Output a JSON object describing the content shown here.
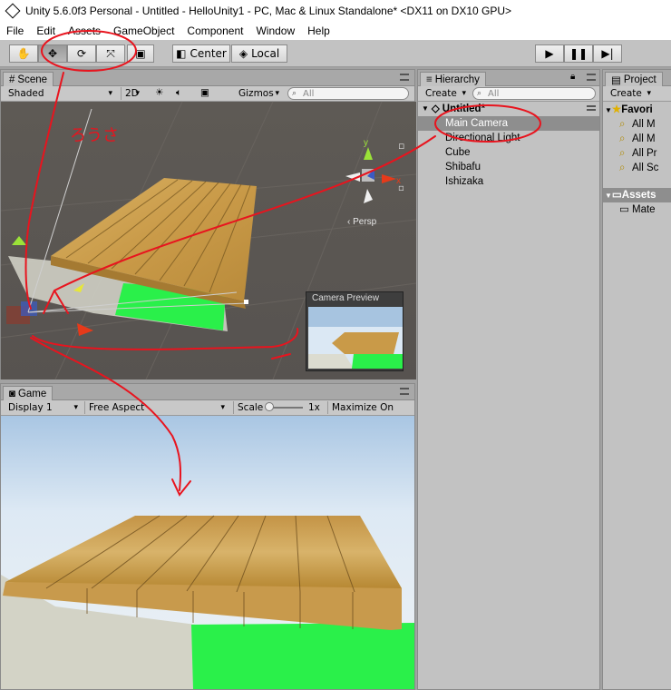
{
  "window": {
    "title": "Unity 5.6.0f3 Personal - Untitled - HelloUnity1 - PC, Mac & Linux Standalone* <DX11 on DX10 GPU>"
  },
  "menu": [
    "File",
    "Edit",
    "Assets",
    "GameObject",
    "Component",
    "Window",
    "Help"
  ],
  "toolbar": {
    "tools": [
      "hand-icon",
      "move-icon",
      "rotate-icon",
      "scale-icon",
      "rect-icon"
    ],
    "pivot": "Center",
    "space": "Local"
  },
  "scene": {
    "tab": "Scene",
    "shading": "Shaded",
    "mode2d": "2D",
    "gizmos": "Gizmos",
    "search_placeholder": "All",
    "persp": "Persp",
    "camera_preview": "Camera Preview",
    "handwritten": "ろうさ"
  },
  "game": {
    "tab": "Game",
    "display": "Display 1",
    "aspect": "Free Aspect",
    "scale_label": "Scale",
    "scale_value": "1x",
    "maximize": "Maximize On Play"
  },
  "hierarchy": {
    "tab": "Hierarchy",
    "create": "Create",
    "search_placeholder": "All",
    "scene_name": "Untitled*",
    "items": [
      "Main Camera",
      "Directional Light",
      "Cube",
      "Shibafu",
      "Ishizaka"
    ],
    "selected": "Main Camera"
  },
  "project": {
    "tab": "Project",
    "create": "Create",
    "favorites_label": "Favori",
    "favorites": [
      "All M",
      "All M",
      "All Pr",
      "All Sc"
    ],
    "assets_label": "Assets",
    "assets_children": [
      "Mate"
    ]
  },
  "colors": {
    "selection": "#8e8e8e",
    "annotation": "#e8141e",
    "grass": "#2af04a",
    "wood": "#c79a45"
  }
}
